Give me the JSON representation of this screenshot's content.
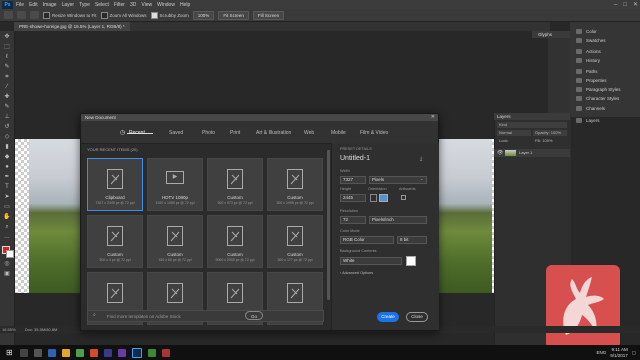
{
  "app": {
    "logo": "Ps"
  },
  "menubar": {
    "items": [
      "File",
      "Edit",
      "Image",
      "Layer",
      "Type",
      "Select",
      "Filter",
      "3D",
      "View",
      "Window",
      "Help"
    ]
  },
  "optionsbar": {
    "resize_label": "Resize Windows to Fit",
    "zoom_all_label": "Zoom All Windows",
    "scrubby_label": "Scrubby Zoom",
    "zoom_100": "100%",
    "fit_screen": "Fit Screen",
    "fill_screen": "Fill Screen"
  },
  "document_tab": {
    "label": "PRE-showe-horeige.jpg @ 16.5% (Layer 1, RGB/8) *"
  },
  "panels": {
    "glyphs_title": "Glyphs",
    "list": [
      "Color",
      "Swatches",
      "Actions",
      "History",
      "Paths",
      "Properties",
      "Paragraph Styles",
      "Character Styles",
      "Channels",
      "Layers"
    ],
    "layers": {
      "title": "Layers",
      "kind": "Kind",
      "blend": "Normal",
      "opacity": "Opacity: 100%",
      "lock": "Lock:",
      "fill": "Fill: 100%",
      "layer_name": "Layer 1"
    }
  },
  "statusbar": {
    "zoom": "16.55%",
    "doc": "Doc: 35.5M/80.8M"
  },
  "dialog": {
    "title": "New Document",
    "tabs": [
      "Recent",
      "Saved",
      "Photo",
      "Print",
      "Art & Illustration",
      "Web",
      "Mobile",
      "Film & Video"
    ],
    "recent_heading": "YOUR RECENT ITEMS  (20)",
    "tiles": [
      {
        "name": "Clipboard",
        "sub": "7327 x 2445 px @ 72 ppi",
        "selected": true
      },
      {
        "name": "HDTV 1080p",
        "sub": "1920 x 1080 px @ 72 ppi",
        "selected": false
      },
      {
        "name": "Custom",
        "sub": "300 x 973 px @ 72 ppi",
        "selected": false
      },
      {
        "name": "Custom",
        "sub": "300 x 1995 px @ 72 ppi",
        "selected": false
      },
      {
        "name": "Custom",
        "sub": "300 x 4 px @ 72 ppi",
        "selected": false
      },
      {
        "name": "Custom",
        "sub": "180 x 60 px @ 72 ppi",
        "selected": false
      },
      {
        "name": "Custom",
        "sub": "9000 x 2000 px @ 72 ppi",
        "selected": false
      },
      {
        "name": "Custom",
        "sub": "300 x 177 px @ 72 ppi",
        "selected": false
      },
      {
        "name": "",
        "sub": "",
        "selected": false
      },
      {
        "name": "",
        "sub": "",
        "selected": false
      },
      {
        "name": "",
        "sub": "",
        "selected": false
      },
      {
        "name": "",
        "sub": "",
        "selected": false
      }
    ],
    "search_placeholder": "Find more templates on Adobe Stock",
    "go_label": "Go",
    "preset_heading": "PRESET DETAILS",
    "doc_name": "Untitled-1",
    "width_label": "Width",
    "width_value": "7327",
    "width_unit": "Pixels",
    "height_label": "Height",
    "height_value": "2445",
    "orientation_label": "Orientation",
    "artboards_label": "Artboards",
    "resolution_label": "Resolution",
    "resolution_value": "72",
    "resolution_unit": "Pixels/Inch",
    "color_mode_label": "Color Mode",
    "color_mode_value": "RGB Color",
    "bit_depth": "8 bit",
    "background_label": "Background Contents",
    "background_value": "White",
    "advanced_label": "Advanced Options",
    "create_label": "Create",
    "close_label": "Close"
  },
  "taskbar": {
    "time": "9:11 AM",
    "date": "9/1/2017",
    "lang": "ENG"
  },
  "colors": {
    "accent": "#1b73e8",
    "brand_red": "#d84f4f"
  }
}
